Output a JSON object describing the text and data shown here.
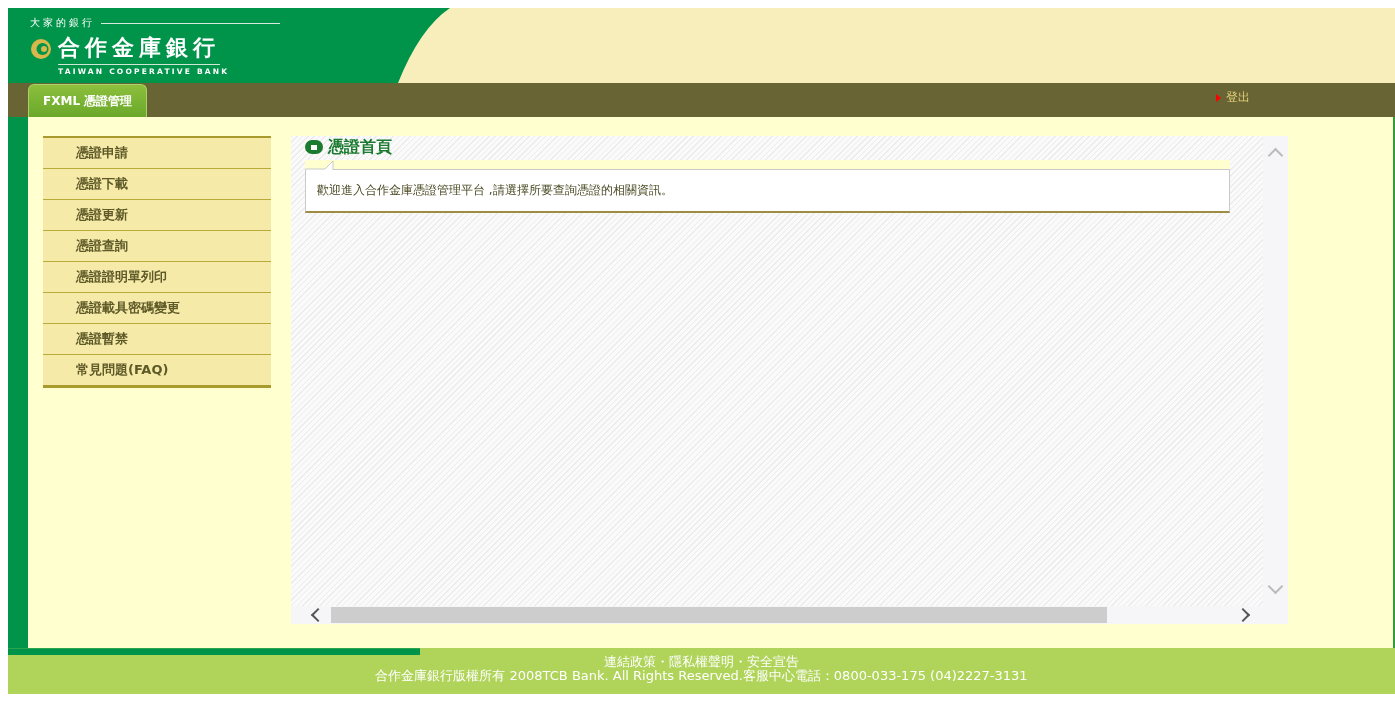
{
  "header": {
    "slogan": "大家的銀行",
    "bank_name": "合作金庫銀行",
    "bank_name_en": "TAIWAN COOPERATIVE BANK"
  },
  "nav": {
    "tabs": [
      {
        "label": "FXML 憑證管理",
        "selected": true
      }
    ],
    "logout": "登出"
  },
  "sidebar": {
    "items": [
      {
        "label": "憑證申請"
      },
      {
        "label": "憑證下載"
      },
      {
        "label": "憑證更新"
      },
      {
        "label": "憑證查詢"
      },
      {
        "label": "憑證證明單列印"
      },
      {
        "label": "憑證載具密碼變更"
      },
      {
        "label": "憑證暫禁"
      },
      {
        "label": "常見問題(FAQ)"
      }
    ]
  },
  "content": {
    "title": "憑證首頁",
    "message": "歡迎進入合作金庫憑證管理平台 ,請選擇所要查詢憑證的相關資訊。"
  },
  "footer": {
    "links": [
      "連結政策",
      "隱私權聲明",
      "安全宣告"
    ],
    "separator": "・",
    "copyright": "合作金庫銀行版權所有 2008TCB Bank. All Rights Reserved.客服中心電話：0800-033-175 (04)2227-3131"
  }
}
